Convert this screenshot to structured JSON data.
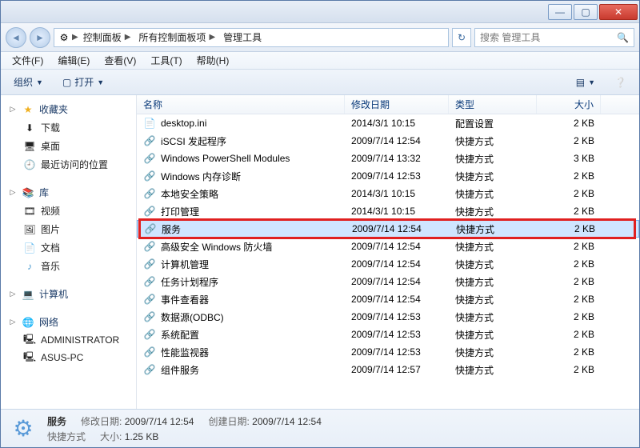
{
  "titlebar": {
    "min": "—",
    "max": "▢",
    "close": "✕"
  },
  "nav": {
    "crumbs": [
      "控制面板",
      "所有控制面板项",
      "管理工具"
    ],
    "search_placeholder": "搜索 管理工具"
  },
  "menus": [
    "文件(F)",
    "编辑(E)",
    "查看(V)",
    "工具(T)",
    "帮助(H)"
  ],
  "toolbar": {
    "organize": "组织",
    "open": "打开"
  },
  "sidebar": {
    "fav_head": "收藏夹",
    "fav_items": [
      "下载",
      "桌面",
      "最近访问的位置"
    ],
    "lib_head": "库",
    "lib_items": [
      "视频",
      "图片",
      "文档",
      "音乐"
    ],
    "computer_head": "计算机",
    "network_head": "网络",
    "network_items": [
      "ADMINISTRATOR",
      "ASUS-PC"
    ]
  },
  "columns": {
    "name": "名称",
    "date": "修改日期",
    "type": "类型",
    "size": "大小"
  },
  "files": [
    {
      "name": "desktop.ini",
      "date": "2014/3/1 10:15",
      "type": "配置设置",
      "size": "2 KB",
      "icon": "📄"
    },
    {
      "name": "iSCSI 发起程序",
      "date": "2009/7/14 12:54",
      "type": "快捷方式",
      "size": "2 KB",
      "icon": "🔗"
    },
    {
      "name": "Windows PowerShell Modules",
      "date": "2009/7/14 13:32",
      "type": "快捷方式",
      "size": "3 KB",
      "icon": "🔗"
    },
    {
      "name": "Windows 内存诊断",
      "date": "2009/7/14 12:53",
      "type": "快捷方式",
      "size": "2 KB",
      "icon": "🔗"
    },
    {
      "name": "本地安全策略",
      "date": "2014/3/1 10:15",
      "type": "快捷方式",
      "size": "2 KB",
      "icon": "🔗"
    },
    {
      "name": "打印管理",
      "date": "2014/3/1 10:15",
      "type": "快捷方式",
      "size": "2 KB",
      "icon": "🔗"
    },
    {
      "name": "服务",
      "date": "2009/7/14 12:54",
      "type": "快捷方式",
      "size": "2 KB",
      "icon": "🔗",
      "selected": true,
      "highlight": true
    },
    {
      "name": "高级安全 Windows 防火墙",
      "date": "2009/7/14 12:54",
      "type": "快捷方式",
      "size": "2 KB",
      "icon": "🔗"
    },
    {
      "name": "计算机管理",
      "date": "2009/7/14 12:54",
      "type": "快捷方式",
      "size": "2 KB",
      "icon": "🔗"
    },
    {
      "name": "任务计划程序",
      "date": "2009/7/14 12:54",
      "type": "快捷方式",
      "size": "2 KB",
      "icon": "🔗"
    },
    {
      "name": "事件查看器",
      "date": "2009/7/14 12:54",
      "type": "快捷方式",
      "size": "2 KB",
      "icon": "🔗"
    },
    {
      "name": "数据源(ODBC)",
      "date": "2009/7/14 12:53",
      "type": "快捷方式",
      "size": "2 KB",
      "icon": "🔗"
    },
    {
      "name": "系统配置",
      "date": "2009/7/14 12:53",
      "type": "快捷方式",
      "size": "2 KB",
      "icon": "🔗"
    },
    {
      "name": "性能监视器",
      "date": "2009/7/14 12:53",
      "type": "快捷方式",
      "size": "2 KB",
      "icon": "🔗"
    },
    {
      "name": "组件服务",
      "date": "2009/7/14 12:57",
      "type": "快捷方式",
      "size": "2 KB",
      "icon": "🔗"
    }
  ],
  "status": {
    "name": "服务",
    "mod_label": "修改日期:",
    "mod_val": "2009/7/14 12:54",
    "create_label": "创建日期:",
    "create_val": "2009/7/14 12:54",
    "type_label": "快捷方式",
    "size_label": "大小:",
    "size_val": "1.25 KB"
  }
}
